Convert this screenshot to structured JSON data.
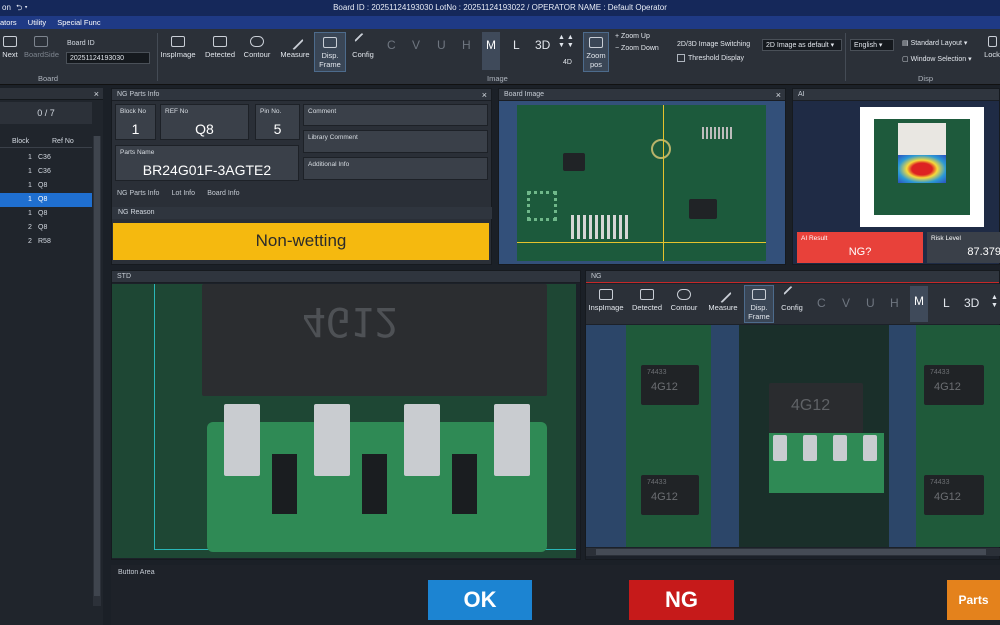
{
  "titlebar": {
    "left": "on",
    "text": "Board ID : 20251124193030  LotNo : 20251124193022 / OPERATOR NAME : Default Operator"
  },
  "menu": [
    "ators",
    "Utility",
    "Special Func"
  ],
  "ribbon": {
    "next": "Next",
    "boardside": "BoardSide",
    "board_id_label": "Board ID",
    "board_id_value": "20251124193030",
    "group_board": "Board",
    "inspimage": "InspImage",
    "detected": "Detected",
    "contour": "Contour",
    "measure": "Measure",
    "disp_frame_1": "Disp.",
    "disp_frame_2": "Frame",
    "config": "Config",
    "letters": [
      "C",
      "V",
      "U",
      "H",
      "M",
      "L",
      "3D"
    ],
    "four_d": "4D",
    "zoom_pos_1": "Zoom",
    "zoom_pos_2": "pos",
    "zoom_up": "Zoom Up",
    "zoom_down": "Zoom Down",
    "switch_label": "2D/3D Image Switching",
    "switch_value": "2D Image as default",
    "threshold": "Threshold Display",
    "group_image": "Image",
    "language": "English",
    "standard_layout": "Standard Layout",
    "window_selection": "Window Selection",
    "lock": "Lock",
    "group_disp": "Disp"
  },
  "left_panel": {
    "count": "0 / 7",
    "col_block": "Block",
    "col_ref": "Ref No",
    "rows": [
      {
        "block": "1",
        "ref": "C36",
        "selected": false
      },
      {
        "block": "1",
        "ref": "C36",
        "selected": false
      },
      {
        "block": "1",
        "ref": "Q8",
        "selected": false
      },
      {
        "block": "1",
        "ref": "Q8",
        "selected": true
      },
      {
        "block": "1",
        "ref": "Q8",
        "selected": false
      },
      {
        "block": "2",
        "ref": "Q8",
        "selected": false
      },
      {
        "block": "2",
        "ref": "R58",
        "selected": false
      }
    ]
  },
  "ng_parts": {
    "title": "NG Parts Info",
    "block_label": "Block No",
    "block_value": "1",
    "ref_label": "REF No",
    "ref_value": "Q8",
    "pin_label": "Pin No.",
    "pin_value": "5",
    "comment": "Comment",
    "library_comment": "Library Comment",
    "additional_info": "Additional Info",
    "parts_name_label": "Parts Name",
    "parts_name_value": "BR24G01F-3AGTE2",
    "tabs": [
      "NG Parts Info",
      "Lot Info",
      "Board Info"
    ],
    "reason_label": "NG Reason",
    "reason_value": "Non-wetting"
  },
  "board_image": {
    "title": "Board Image"
  },
  "ai": {
    "title": "AI",
    "result_label": "AI Result",
    "result_value": "NG?",
    "risk_label": "Risk Level",
    "risk_value": "87.379"
  },
  "std": {
    "title": "STD",
    "marking": "4G12"
  },
  "ng": {
    "title": "NG",
    "inspimage": "InspImage",
    "detected": "Detected",
    "contour": "Contour",
    "measure": "Measure",
    "disp_frame_1": "Disp.",
    "disp_frame_2": "Frame",
    "config": "Config",
    "letters": [
      "C",
      "V",
      "U",
      "H",
      "M",
      "L",
      "3D"
    ],
    "marking": "4G12",
    "marking_small": "74433"
  },
  "buttons": {
    "area_label": "Button Area",
    "ok": "OK",
    "ng": "NG",
    "parts": "Parts"
  },
  "colors": {
    "ok": "#1c84d2",
    "ng": "#c61a1a",
    "parts": "#e4821c",
    "ng_reason": "#f5b90f",
    "ai_result": "#e8413a"
  }
}
